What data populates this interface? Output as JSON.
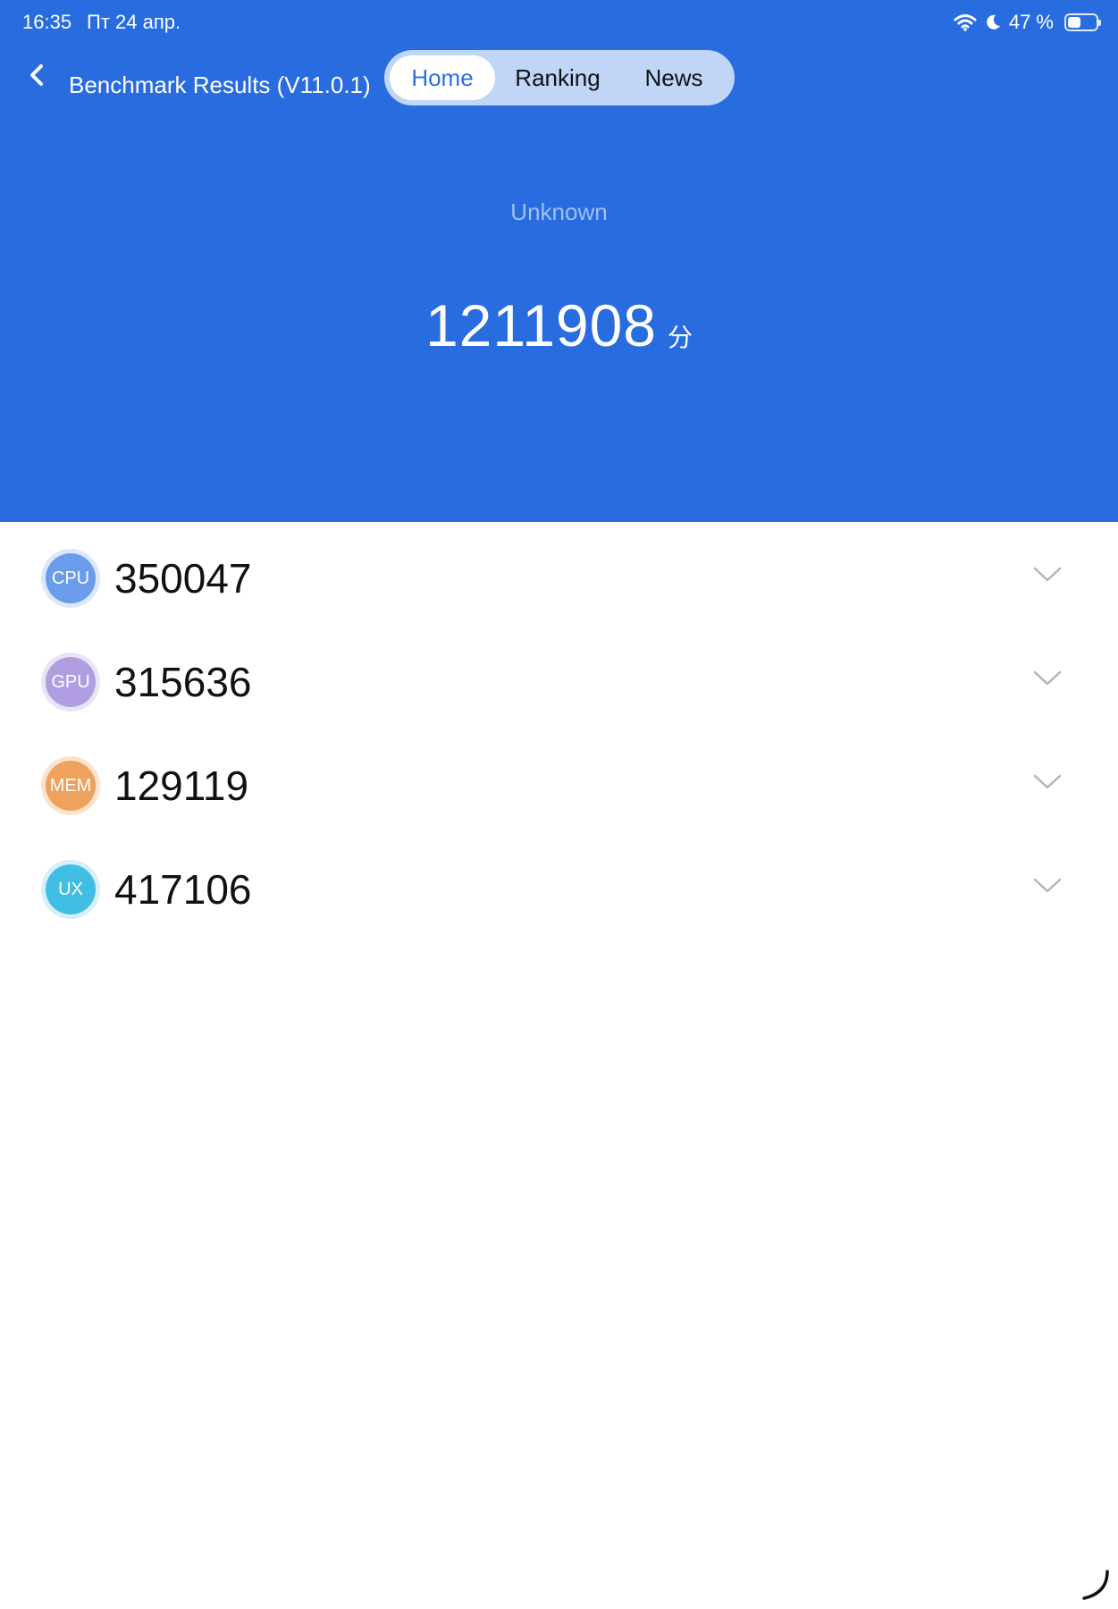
{
  "status_bar": {
    "time": "16:35",
    "date": "Пт 24 апр.",
    "battery_percent_text": "47 %",
    "battery_level": 0.47,
    "icons": [
      "wifi-icon",
      "moon-icon",
      "battery-icon"
    ]
  },
  "nav": {
    "back_icon": "chevron-left-icon",
    "title": "Benchmark Results (V11.0.1)",
    "tabs": [
      {
        "label": "Home",
        "active": true
      },
      {
        "label": "Ranking",
        "active": false
      },
      {
        "label": "News",
        "active": false
      }
    ]
  },
  "summary": {
    "device": "Unknown",
    "total_score": "1211908",
    "unit": "分"
  },
  "scores": [
    {
      "badge": "CPU",
      "value": "350047",
      "color": "#6A9CEB",
      "ring": "#DCE7F9"
    },
    {
      "badge": "GPU",
      "value": "315636",
      "color": "#B09EE0",
      "ring": "#EAE4F7"
    },
    {
      "badge": "MEM",
      "value": "129119",
      "color": "#EFA15E",
      "ring": "#FBE3CD"
    },
    {
      "badge": "UX",
      "value": "417106",
      "color": "#41BEE3",
      "ring": "#D6EFF8"
    }
  ],
  "colors": {
    "header_bg": "#286CE0",
    "tab_active_text": "#2C6FE0",
    "segment_bg": "#BFD6F7"
  }
}
